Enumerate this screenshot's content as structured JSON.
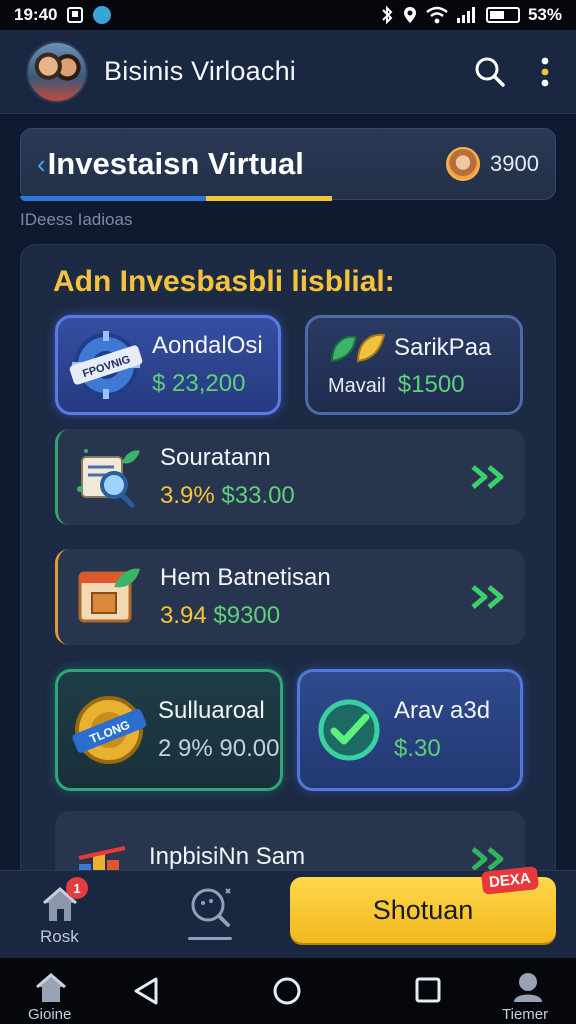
{
  "status_bar": {
    "time": "19:40",
    "battery": "53%"
  },
  "app": {
    "title": "Bisinis Virloachi"
  },
  "section": {
    "title": "Investaisn Virtual",
    "coins": "3900"
  },
  "subcaption": "IDeess Iadioas",
  "panel": {
    "heading": "Adn Invesbasbli lisblial:",
    "tiles": [
      {
        "name": "AondalOsi",
        "value": "$ 23,200",
        "badge_text": "FPOVNIG"
      },
      {
        "name": "SarikPaa",
        "label": "Mavail",
        "value": "$1500"
      }
    ],
    "rows": [
      {
        "name": "Souratann",
        "pct": "3.9%",
        "value": "$33.00"
      },
      {
        "name": "Hem Batnetisan",
        "pct": "3.94",
        "value": "$9300"
      }
    ],
    "tiles2": [
      {
        "name": "Sulluaroal",
        "pct": "2 9%",
        "value": "90.00",
        "badge_text": "TLONG"
      },
      {
        "name": "Arav a3d",
        "value": "$.30"
      }
    ],
    "partial_row": {
      "name": "InpbisiNn Sam"
    }
  },
  "action_bar": {
    "home_label": "Rosk",
    "home_badge": "1",
    "cta_label": "Shotuan",
    "cta_tag": "DEXA"
  },
  "system_nav": {
    "left_label": "Gioine",
    "right_label": "Tiemer"
  },
  "colors": {
    "accent_yellow": "#f3c534",
    "accent_green": "#5fd07a",
    "background": "#0f1a30"
  }
}
